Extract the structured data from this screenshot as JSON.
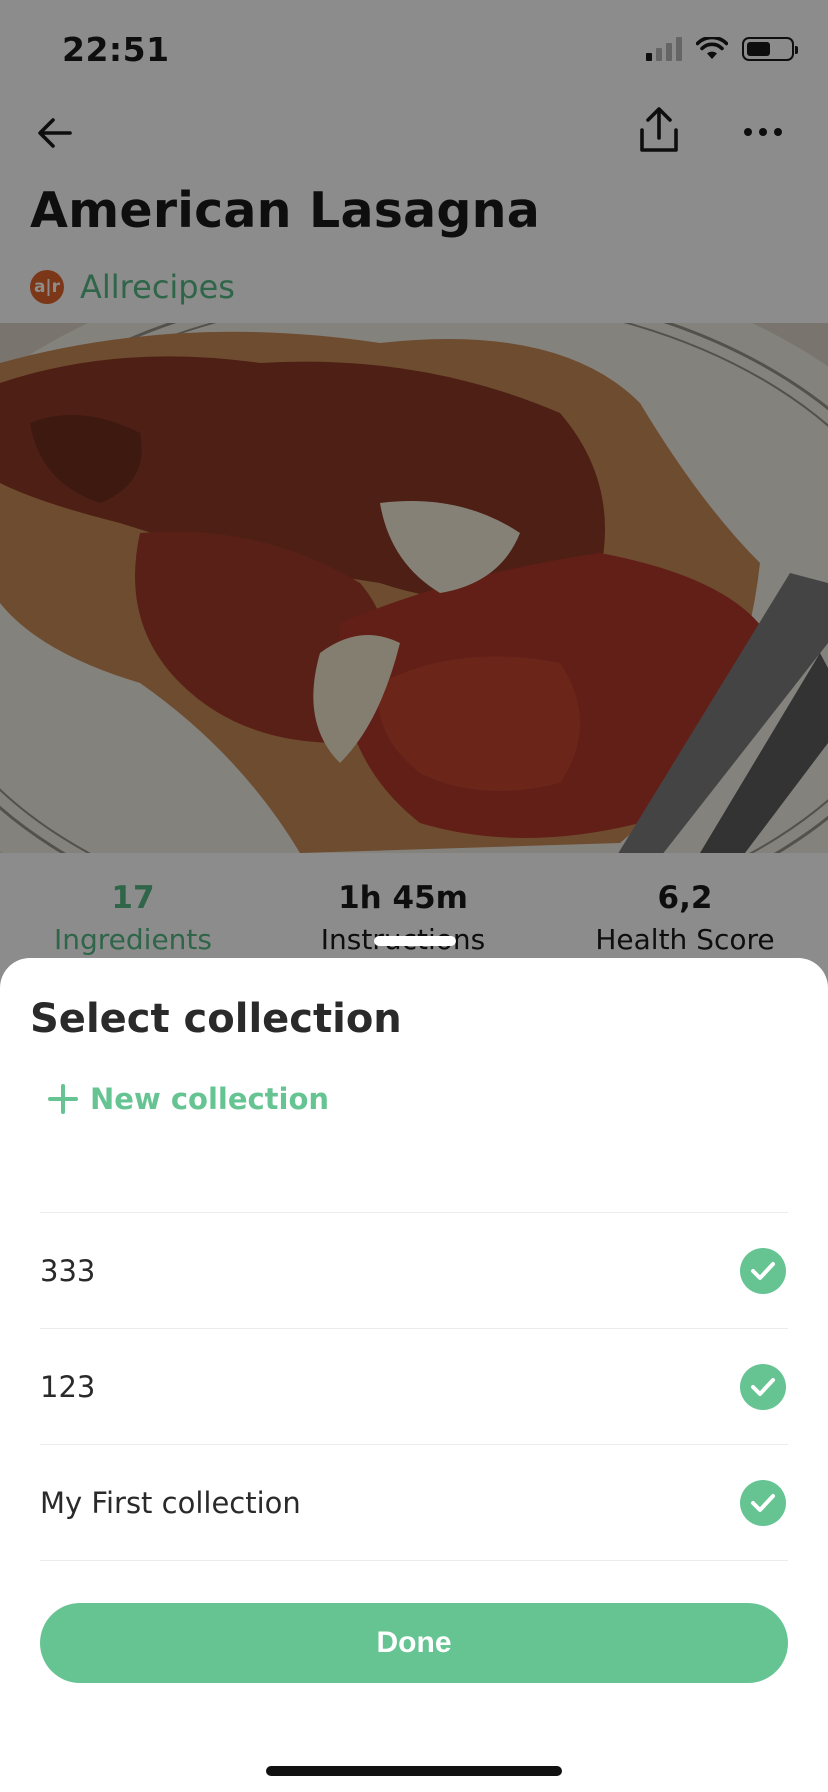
{
  "status_bar": {
    "time": "22:51"
  },
  "recipe": {
    "title": "American Lasagna",
    "source": {
      "logo_text": "a|r",
      "name": "Allrecipes"
    }
  },
  "stats": [
    {
      "value": "17",
      "label": "Ingredients",
      "active": true
    },
    {
      "value": "1h 45m",
      "label": "Instructions",
      "active": false
    },
    {
      "value": "6,2",
      "label": "Health Score",
      "active": false
    }
  ],
  "sheet": {
    "title": "Select collection",
    "new_collection_label": "New collection",
    "collections": [
      {
        "name": "333",
        "selected": true
      },
      {
        "name": "123",
        "selected": true
      },
      {
        "name": "My First collection",
        "selected": true
      }
    ],
    "done_label": "Done"
  },
  "colors": {
    "accent": "#66c493",
    "source_green": "#57b886",
    "overlay": "rgba(0,0,0,0.45)"
  },
  "icons": [
    "back-arrow-icon",
    "share-icon",
    "more-icon",
    "plus-icon",
    "check-icon",
    "wifi-icon",
    "battery-icon",
    "signal-icon"
  ]
}
